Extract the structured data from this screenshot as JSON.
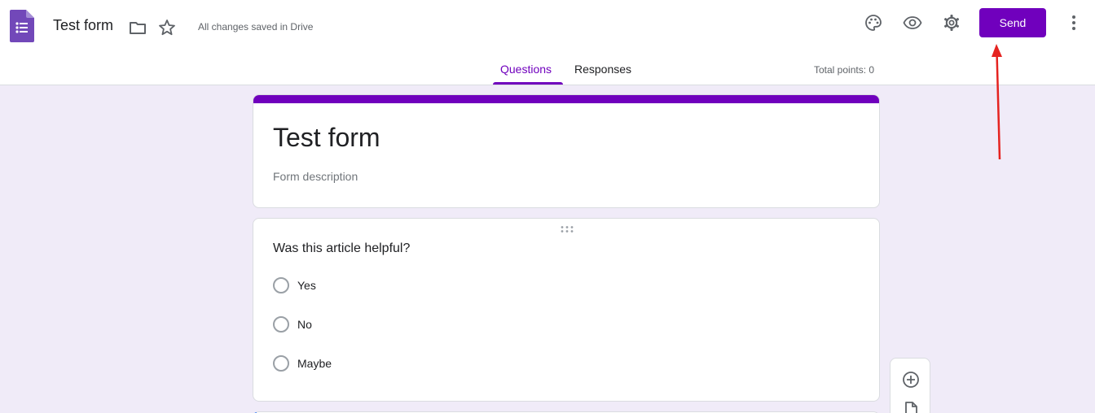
{
  "header": {
    "doc_title": "Test form",
    "save_status": "All changes saved in Drive",
    "send_label": "Send"
  },
  "tabs": {
    "questions": "Questions",
    "responses": "Responses",
    "active": "Questions"
  },
  "total_points": "Total points: 0",
  "form": {
    "title": "Test form",
    "description_placeholder": "Form description"
  },
  "question": {
    "text": "Was this article helpful?",
    "options": [
      "Yes",
      "No",
      "Maybe"
    ]
  },
  "icons": {
    "app": "google-forms-icon",
    "folder": "folder-icon",
    "star": "star-icon",
    "palette": "palette-icon",
    "preview": "eye-icon",
    "settings": "gear-icon",
    "more": "more-vert-icon",
    "add_question": "add-circle-icon",
    "import_questions": "import-file-icon"
  },
  "colors": {
    "accent": "#7000bd",
    "background": "#f0ebf8",
    "annotation": "#e52320"
  }
}
